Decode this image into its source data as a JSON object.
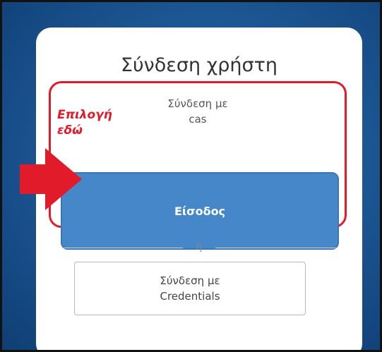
{
  "card": {
    "title": "Σύνδεση χρήστη",
    "cas": {
      "line1": "Σύνδεση με",
      "line2": "cas",
      "button_label": "Είσοδος"
    },
    "divider_text": "ή",
    "credentials_button": {
      "line1": "Σύνδεση με",
      "line2": "Credentials"
    }
  },
  "annotation": {
    "line1": "Επιλογή",
    "line2": "εδώ",
    "arrow_icon": "right-arrow-icon",
    "color": "#e21b2a"
  },
  "colors": {
    "background": "#1e5a99",
    "primary_button": "#4687c9",
    "highlight": "#e21b2a"
  }
}
